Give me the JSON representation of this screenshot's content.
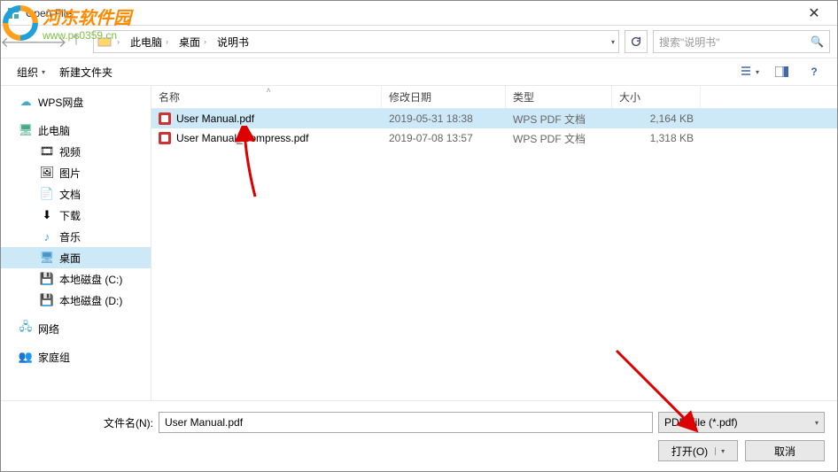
{
  "title": "Open File",
  "breadcrumbs": [
    "此电脑",
    "桌面",
    "说明书"
  ],
  "search_placeholder": "搜索\"说明书\"",
  "toolbar": {
    "organize": "组织",
    "newfolder": "新建文件夹"
  },
  "columns": {
    "name": "名称",
    "date": "修改日期",
    "type": "类型",
    "size": "大小"
  },
  "sidebar": {
    "wps": "WPS网盘",
    "thispc": "此电脑",
    "video": "视频",
    "pictures": "图片",
    "documents": "文档",
    "downloads": "下载",
    "music": "音乐",
    "desktop": "桌面",
    "diskc": "本地磁盘 (C:)",
    "diskd": "本地磁盘 (D:)",
    "network": "网络",
    "homegroup": "家庭组"
  },
  "files": [
    {
      "name": "User Manual.pdf",
      "date": "2019-05-31 18:38",
      "type": "WPS PDF 文档",
      "size": "2,164 KB"
    },
    {
      "name": "User Manual_Compress.pdf",
      "date": "2019-07-08 13:57",
      "type": "WPS PDF 文档",
      "size": "1,318 KB"
    }
  ],
  "footer": {
    "filename_label": "文件名(N):",
    "filename_value": "User Manual.pdf",
    "filter": "PDF File (*.pdf)",
    "open": "打开(O)",
    "cancel": "取消"
  },
  "watermark": {
    "cn": "河东软件园",
    "url": "www.pc0359.cn"
  }
}
